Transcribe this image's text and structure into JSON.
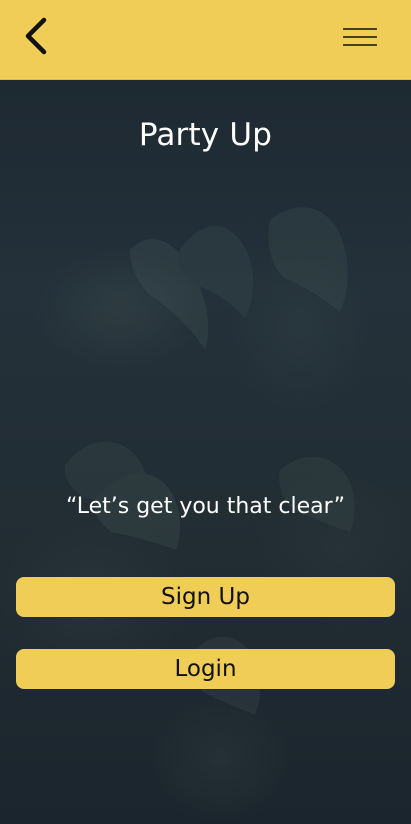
{
  "app": {
    "title": "Party Up",
    "quote": "“Let’s get you that clear”"
  },
  "header": {
    "back_icon": "chevron-left-icon",
    "menu_icon": "hamburger-menu-icon"
  },
  "actions": {
    "signup_label": "Sign Up",
    "login_label": "Login"
  },
  "colors": {
    "accent": "#efcd57",
    "background": "#1f2a33",
    "text_light": "#ffffff",
    "text_dark": "#111111"
  }
}
